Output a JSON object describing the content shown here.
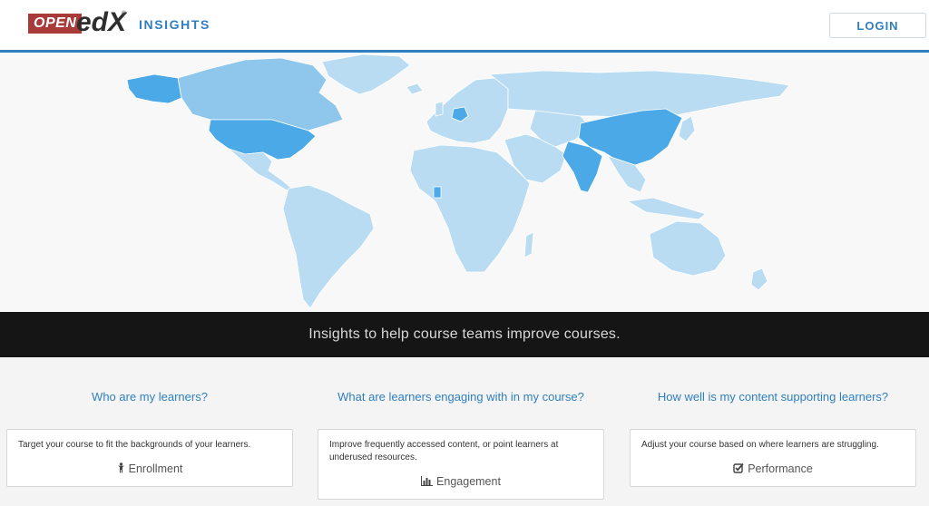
{
  "header": {
    "logo": {
      "open": "OPEN",
      "edx": "edX",
      "tm": "®"
    },
    "title": "INSIGHTS",
    "login_label": "LOGIN"
  },
  "map": {
    "colors": {
      "base": "#b9dcf2",
      "medium": "#8fc7ec",
      "high": "#4aa9e6",
      "ocean": "#f8f8f8"
    },
    "highlighted_regions": [
      "United States",
      "China",
      "India",
      "Alaska"
    ]
  },
  "banner": {
    "text": "Insights to help course teams improve courses."
  },
  "features": [
    {
      "question": "Who are my learners?",
      "description": "Target your course to fit the backgrounds of your learners.",
      "link_label": "Enrollment",
      "icon": "child-icon"
    },
    {
      "question": "What are learners engaging with in my course?",
      "description": "Improve frequently accessed content, or point learners at underused resources.",
      "link_label": "Engagement",
      "icon": "bar-chart-icon"
    },
    {
      "question": "How well is my content supporting learners?",
      "description": "Adjust your course based on where learners are struggling.",
      "link_label": "Performance",
      "icon": "check-square-icon"
    }
  ]
}
